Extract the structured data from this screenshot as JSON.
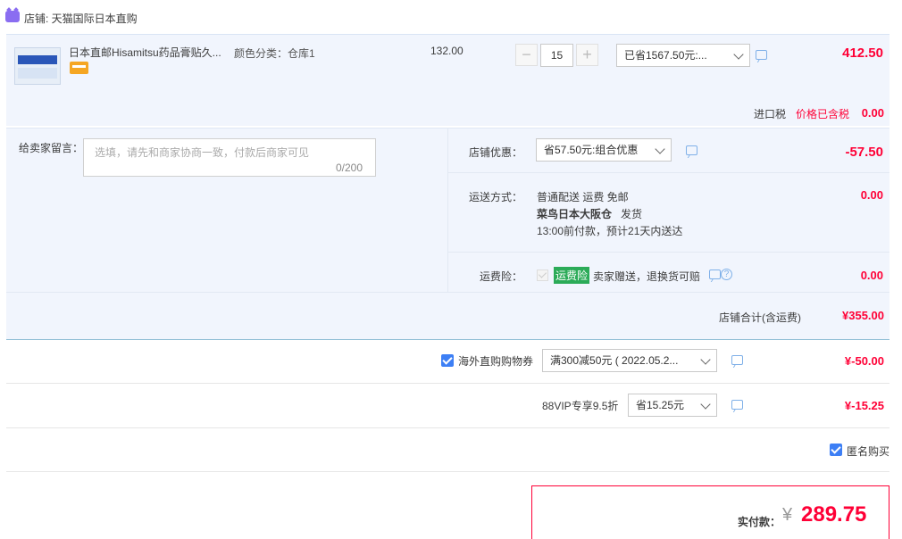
{
  "store": {
    "label": "店铺: 天猫国际日本直购"
  },
  "item": {
    "title": "日本直邮Hisamitsu药品膏贴久...",
    "sku": "颜色分类：仓库1",
    "unit_price": "132.00",
    "quantity": "15",
    "qty_minus": "−",
    "qty_plus": "+",
    "discount_select": "已省1567.50元:...",
    "total": "412.50",
    "tax_label": "进口税",
    "tax_note": "价格已含税",
    "tax_value": "0.00"
  },
  "message": {
    "label": "给卖家留言：",
    "placeholder": "选填，请先和商家协商一致，付款后商家可见",
    "count": "0/200"
  },
  "shop_promo": {
    "label": "店铺优惠：",
    "selected": "省57.50元:组合优惠",
    "value": "-57.50"
  },
  "shipping": {
    "label": "运送方式：",
    "line1": "普通配送 运费 免邮",
    "line2": "菜鸟日本大阪仓",
    "line2b": "发货",
    "line3": "13:00前付款，预计21天内送达",
    "value": "0.00"
  },
  "insurance": {
    "label": "运费险：",
    "badge": "运费险",
    "text": "卖家赠送，退换货可赔",
    "value": "0.00",
    "help": "?"
  },
  "shop_total": {
    "label": "店铺合计(含运费)",
    "value": "¥355.00"
  },
  "coupon": {
    "label": "海外直购购物券",
    "selected": "满300减50元 ( 2022.05.2...",
    "value": "¥-50.00"
  },
  "vip": {
    "label": "88VIP专享9.5折",
    "selected": "省15.25元",
    "value": "¥-15.25"
  },
  "anonymous": {
    "label": "匿名购买"
  },
  "payment": {
    "label": "实付款：",
    "currency": "¥",
    "value": "289.75"
  },
  "colors": {
    "accent": "#ff0036",
    "check": "#3d7ff5",
    "panel": "#f1f5fd",
    "badge": "#2bab58"
  },
  "icons": [
    "tmall-cat-icon",
    "card-icon",
    "message-icon",
    "help-icon",
    "chevron-down-icon",
    "checkmark-icon"
  ]
}
